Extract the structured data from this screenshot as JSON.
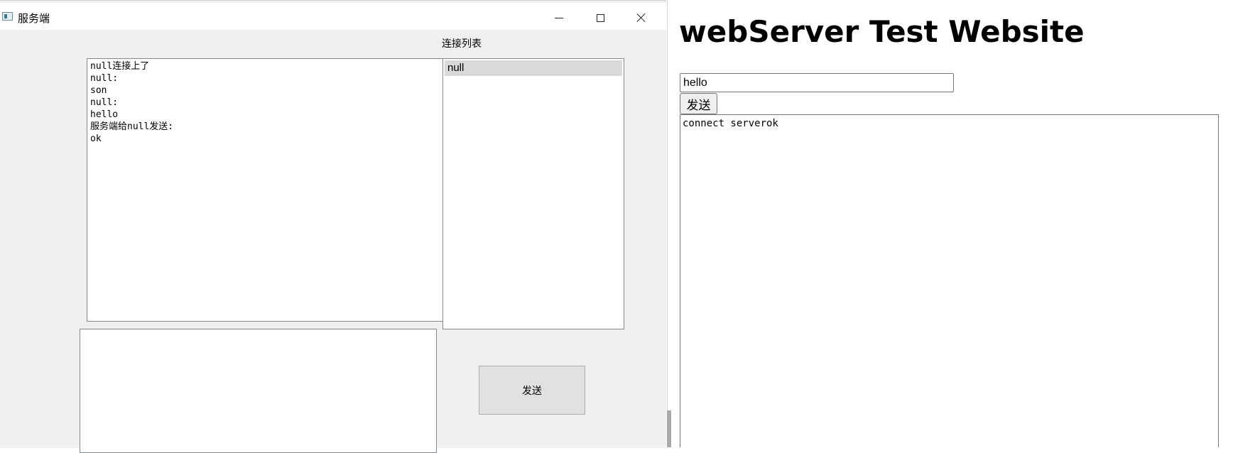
{
  "server_window": {
    "title": "服务端",
    "controls": {
      "minimize_icon": "minimize-icon",
      "maximize_icon": "maximize-icon",
      "close_icon": "close-icon"
    },
    "connection_list_label": "连接列表",
    "message_log": [
      "null连接上了",
      "null:",
      "son",
      "null:",
      "hello",
      "服务端给null发送:",
      "ok"
    ],
    "connections": [
      "null"
    ],
    "message_input_value": "",
    "send_label": "发送"
  },
  "web_page": {
    "title": "webServer Test Website",
    "input_value": "hello",
    "send_label": "发送",
    "output_text": "connect serverok"
  }
}
